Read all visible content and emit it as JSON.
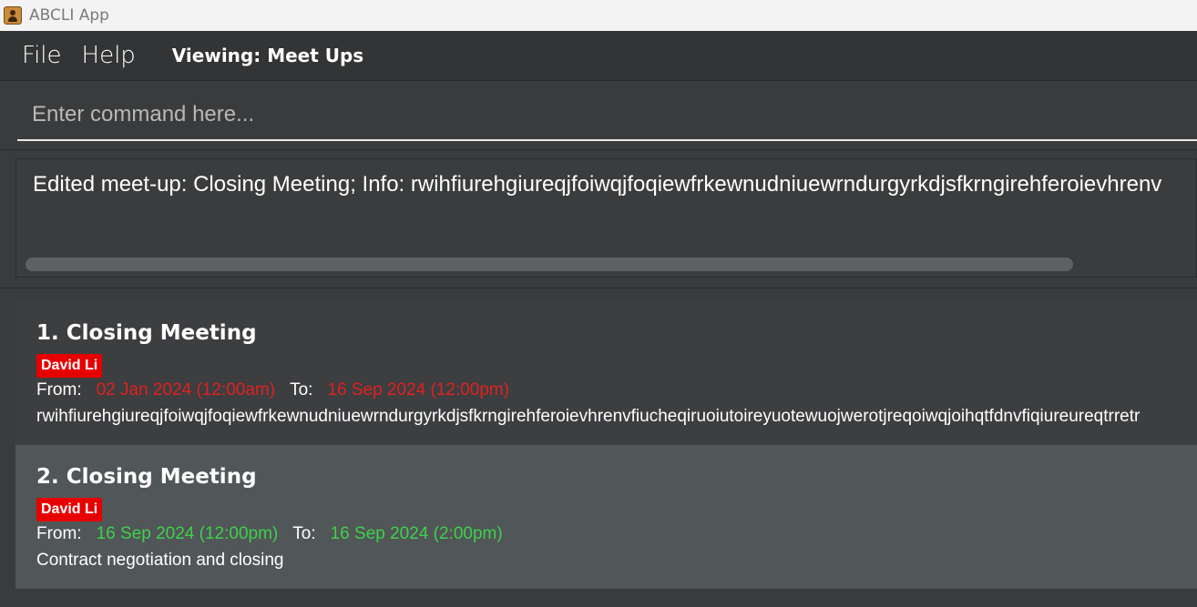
{
  "window": {
    "title": "ABCLI App",
    "icon": "address-book-icon"
  },
  "menubar": {
    "file_label": "File",
    "help_label": "Help",
    "viewing_label": "Viewing: Meet Ups"
  },
  "command": {
    "placeholder": "Enter command here...",
    "value": ""
  },
  "result": {
    "text": "Edited meet-up: Closing Meeting; Info: rwihfiurehgiureqjfoiwqjfoqiewfrkewnudniuewrndurgyrkdjsfkrngirehferoievhrenv"
  },
  "meetups": [
    {
      "title": "1. Closing Meeting",
      "tag": "David Li",
      "from_label": "From:",
      "from": "02 Jan 2024 (12:00am)",
      "to_label": "To:",
      "to": "16 Sep 2024 (12:00pm)",
      "date_color": "#e02020",
      "info": "rwihfiurehgiureqjfoiwqjfoqiewfrkewnudniuewrndurgyrkdjsfkrngirehferoievhrenvfiucheqiruoiutoireyuotewuojwerotjreqoiwqjoihqtfdnvfiqiureureqtrretr"
    },
    {
      "title": "2. Closing Meeting",
      "tag": "David Li",
      "from_label": "From:",
      "from": "16 Sep 2024 (12:00pm)",
      "to_label": "To:",
      "to": "16 Sep 2024 (2:00pm)",
      "date_color": "#3fd04a",
      "info": "Contract negotiation and closing"
    }
  ],
  "colors": {
    "tag_bg": "#e60000",
    "past_date": "#e02020",
    "upcoming_date": "#3fd04a"
  }
}
